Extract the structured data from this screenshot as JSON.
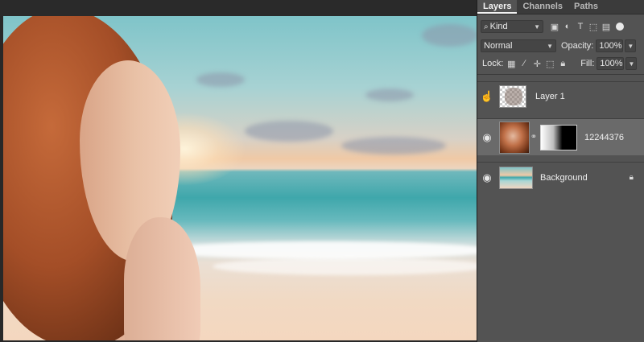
{
  "panel": {
    "tabs": [
      {
        "label": "Layers"
      },
      {
        "label": "Channels"
      },
      {
        "label": "Paths"
      }
    ],
    "filter": {
      "search_icon": "search-icon",
      "value": "Kind"
    },
    "blend": {
      "mode": "Normal",
      "opacity_label": "Opacity:",
      "opacity_value": "100%"
    },
    "lock": {
      "label": "Lock:",
      "fill_label": "Fill:",
      "fill_value": "100%"
    },
    "layers": [
      {
        "name": "Layer 1",
        "visible": true,
        "selected": false
      },
      {
        "name": "12244376",
        "visible": true,
        "selected": true
      },
      {
        "name": "Background",
        "visible": true,
        "selected": false,
        "locked": true
      }
    ]
  }
}
